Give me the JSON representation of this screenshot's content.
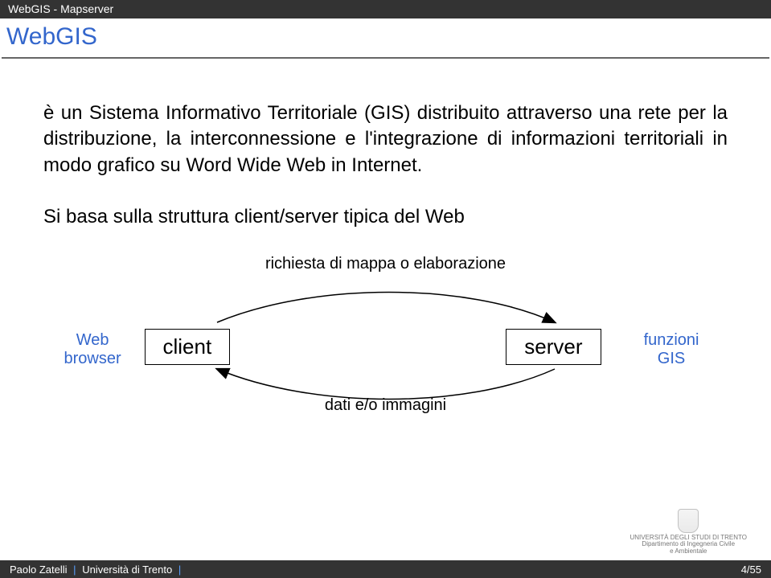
{
  "header": {
    "context": "WebGIS - Mapserver",
    "title": "WebGIS"
  },
  "content": {
    "paragraph1": "è un Sistema Informativo Territoriale (GIS) distribuito attraverso una rete per la distribuzione, la interconnessione e l'integrazione di informazioni territoriali in modo grafico su Word Wide Web in Internet.",
    "paragraph2": "Si basa sulla struttura client/server tipica del Web"
  },
  "diagram": {
    "top_curve_label": "richiesta di mappa o elaborazione",
    "web_browser_label_line1": "Web",
    "web_browser_label_line2": "browser",
    "client_box": "client",
    "server_box": "server",
    "funzioni_label_line1": "funzioni",
    "funzioni_label_line2": "GIS",
    "bottom_curve_label": "dati e/o immagini"
  },
  "footer": {
    "author": "Paolo Zatelli",
    "affiliation": "Università di Trento",
    "separator": "|",
    "logo_line1": "UNIVERSITÀ DEGLI STUDI DI TRENTO",
    "logo_line2": "Dipartimento di Ingegneria Civile",
    "logo_line3": "e Ambientale",
    "page": "4/55"
  }
}
